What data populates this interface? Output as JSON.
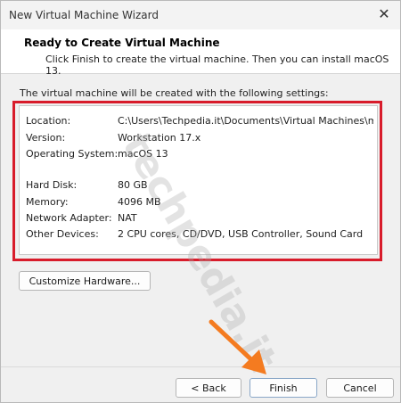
{
  "window": {
    "title": "New Virtual Machine Wizard",
    "close_glyph": "✕"
  },
  "header": {
    "title": "Ready to Create Virtual Machine",
    "subtitle": "Click Finish to create the virtual machine. Then you can install macOS 13."
  },
  "intro_text": "The virtual machine will be created with the following settings:",
  "settings": [
    {
      "label": "Location:",
      "value": "C:\\Users\\Techpedia.it\\Documents\\Virtual Machines\\m..."
    },
    {
      "label": "Version:",
      "value": "Workstation 17.x"
    },
    {
      "label": "Operating System:",
      "value": "macOS 13"
    },
    {
      "label": "Hard Disk:",
      "value": "80 GB"
    },
    {
      "label": "Memory:",
      "value": "4096 MB"
    },
    {
      "label": "Network Adapter:",
      "value": "NAT"
    },
    {
      "label": "Other Devices:",
      "value": "2 CPU cores, CD/DVD, USB Controller, Sound Card"
    }
  ],
  "buttons": {
    "customize": "Customize Hardware...",
    "back": "< Back",
    "finish": "Finish",
    "cancel": "Cancel"
  },
  "watermark": "techpedia.it",
  "colors": {
    "highlight": "#d81c2b",
    "arrow": "#f47b20"
  }
}
